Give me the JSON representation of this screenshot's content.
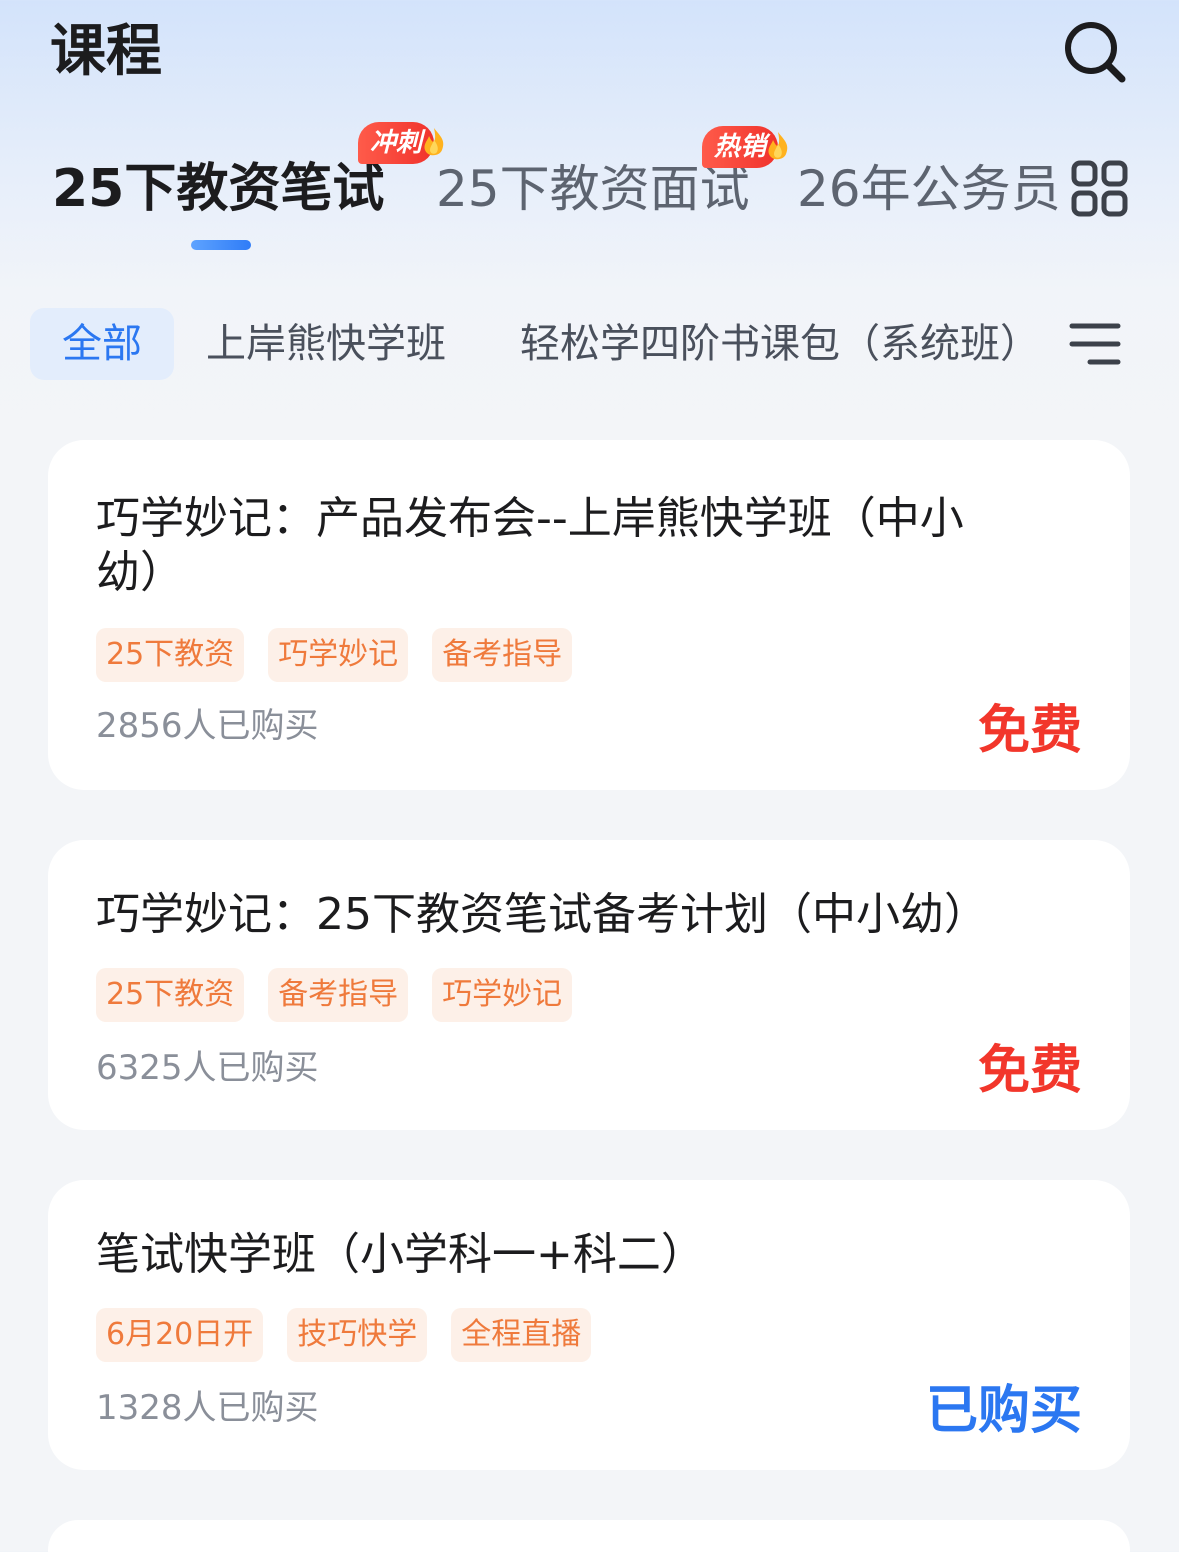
{
  "header": {
    "title": "课程",
    "search_icon": "search-icon"
  },
  "top_tabs": [
    {
      "label": "25下教资笔试",
      "active": true
    },
    {
      "label": "25下教资面试",
      "badge": "冲刺"
    },
    {
      "label": "26年公务员",
      "badge": "热销"
    }
  ],
  "more_tabs_icon": "grid-icon",
  "filter_chips": [
    {
      "label": "全部",
      "active": true
    },
    {
      "label": "上岸熊快学班"
    },
    {
      "label": "轻松学四阶书课包（系统班）"
    }
  ],
  "filter_menu_icon": "menu-icon",
  "courses": [
    {
      "title": "巧学妙记：产品发布会--上岸熊快学班（中小幼）",
      "tags": [
        "25下教资",
        "巧学妙记",
        "备考指导"
      ],
      "buyers": "2856人已购买",
      "price": "免费"
    },
    {
      "title": "巧学妙记：25下教资笔试备考计划（中小幼）",
      "tags": [
        "25下教资",
        "备考指导",
        "巧学妙记"
      ],
      "buyers": "6325人已购买",
      "price": "免费"
    },
    {
      "title": "笔试快学班（小学科一+科二）",
      "tags": [
        "6月20日开",
        "技巧快学",
        "全程直播"
      ],
      "buyers": "1328人已购买",
      "price": "已购买"
    }
  ],
  "colors": {
    "accent_blue": "#2b77f1",
    "price_red": "#f2362b",
    "tag_orange": "#ef7a3c",
    "tag_bg": "#fdf0e8",
    "badge_red": "#f0322c"
  }
}
